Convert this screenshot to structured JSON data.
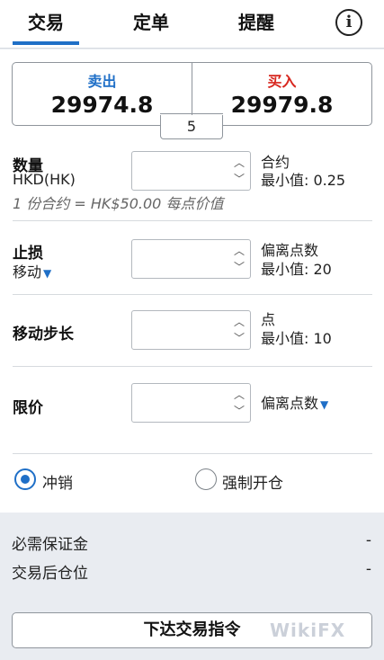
{
  "tabs": [
    {
      "label": "交易"
    },
    {
      "label": "定单"
    },
    {
      "label": "提醒"
    }
  ],
  "info_icon_glyph": "i",
  "sell": {
    "label": "卖出",
    "price": "29974.8"
  },
  "buy": {
    "label": "买入",
    "price": "29979.8"
  },
  "spread": "5",
  "quantity": {
    "label": "数量",
    "currency": "HKD(HK)",
    "unit": "合约",
    "min": "最小值: 0.25",
    "note": "1 份合约 = HK$50.00 每点价值",
    "value": ""
  },
  "stop": {
    "label": "止损",
    "mode": "移动",
    "unit": "偏离点数",
    "min": "最小值: 20",
    "value": ""
  },
  "trailing_step": {
    "label": "移动步长",
    "unit": "点",
    "min": "最小值: 10",
    "value": ""
  },
  "limit": {
    "label": "限价",
    "unit": "偏离点数",
    "value": ""
  },
  "position_mode": {
    "options": [
      "冲销",
      "强制开仓"
    ],
    "selected": "冲销"
  },
  "summary": {
    "margin_label": "必需保证金",
    "margin_value": "-",
    "after_label": "交易后仓位",
    "after_value": "-"
  },
  "submit_label": "下达交易指令",
  "watermark": "WikiFX",
  "colors": {
    "accent": "#1f6fc7",
    "sell": "#1f6fc7",
    "buy": "#d7261e"
  }
}
